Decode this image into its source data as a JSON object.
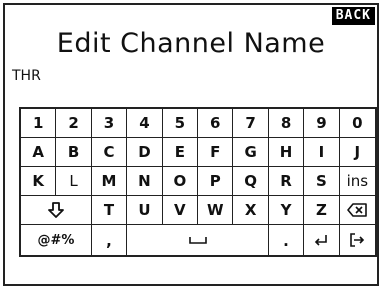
{
  "header": {
    "back_label": "BACK",
    "title": "Edit Channel Name"
  },
  "channel": {
    "name": "THR"
  },
  "keyboard": {
    "row1": [
      "1",
      "2",
      "3",
      "4",
      "5",
      "6",
      "7",
      "8",
      "9",
      "0"
    ],
    "row2": [
      "A",
      "B",
      "C",
      "D",
      "E",
      "F",
      "G",
      "H",
      "I",
      "J"
    ],
    "row3": [
      "K",
      "L",
      "M",
      "N",
      "O",
      "P",
      "Q",
      "R",
      "S",
      "ins"
    ],
    "row4": [
      "T",
      "U",
      "V",
      "W",
      "X",
      "Y",
      "Z"
    ],
    "row5": {
      "symbols": "@#%",
      "comma": ",",
      "period": "."
    },
    "icons": {
      "shift": "shift-arrow-icon",
      "backspace": "backspace-icon",
      "space": "space-icon",
      "enter": "enter-icon",
      "exit": "exit-icon"
    }
  }
}
